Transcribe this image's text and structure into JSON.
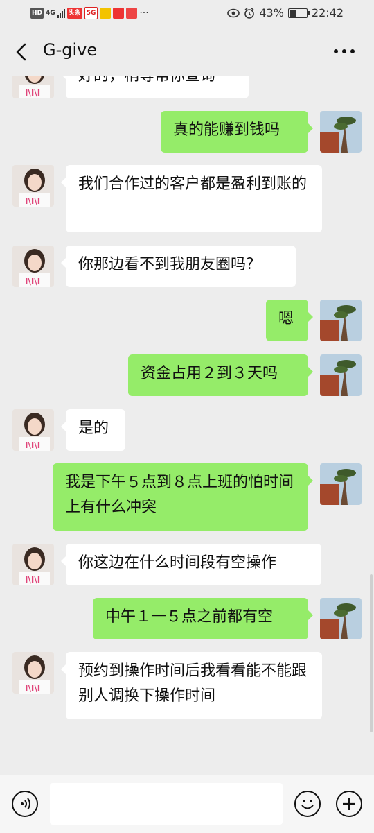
{
  "status_bar": {
    "hd": "HD",
    "network": "4G",
    "apps": [
      "头条",
      "5G",
      "",
      "",
      ""
    ],
    "battery": "43%",
    "time": "22:42",
    "battery_level": 0.43
  },
  "header": {
    "title": "G-give",
    "back_icon": "chevron-left-icon",
    "more_icon": "more-dots-icon"
  },
  "messages": [
    {
      "side": "left",
      "text": "好的，稍等帮你查询"
    },
    {
      "side": "right",
      "text": "真的能赚到钱吗"
    },
    {
      "side": "left",
      "text": "我们合作过的客户都是盈利到账的"
    },
    {
      "side": "left",
      "text": "你那边看不到我朋友圈吗？"
    },
    {
      "side": "right",
      "text": "嗯"
    },
    {
      "side": "right",
      "text": "资金占用２到３天吗"
    },
    {
      "side": "left",
      "text": "是的"
    },
    {
      "side": "right",
      "text": "我是下午５点到８点上班的怕时间上有什么冲突"
    },
    {
      "side": "left",
      "text": "你这边在什么时间段有空操作"
    },
    {
      "side": "right",
      "text": "中午１一５点之前都有空"
    },
    {
      "side": "left",
      "text": "预约到操作时间后我看看能不能跟别人调换下操作时间"
    }
  ],
  "input_bar": {
    "voice_icon": "voice-icon",
    "emoji_icon": "emoji-icon",
    "plus_icon": "plus-icon",
    "placeholder": ""
  },
  "colors": {
    "background": "#ededed",
    "bubble_self": "#95ec69",
    "bubble_other": "#ffffff"
  }
}
